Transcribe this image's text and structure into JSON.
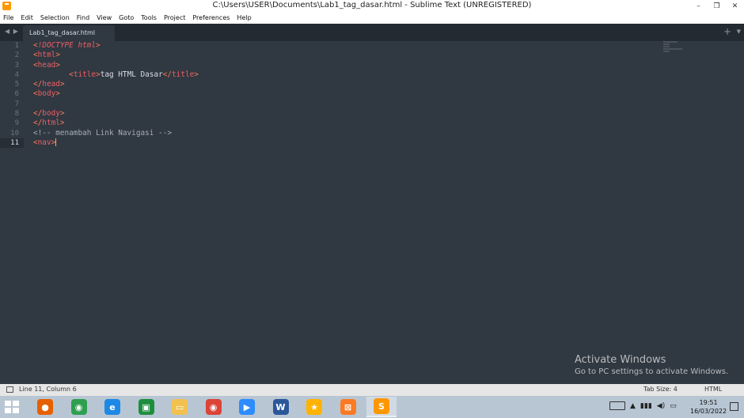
{
  "window": {
    "title": "C:\\Users\\USER\\Documents\\Lab1_tag_dasar.html - Sublime Text (UNREGISTERED)",
    "minimize_glyph": "–",
    "maximize_glyph": "❐",
    "close_glyph": "✕"
  },
  "menu": [
    "File",
    "Edit",
    "Selection",
    "Find",
    "View",
    "Goto",
    "Tools",
    "Project",
    "Preferences",
    "Help"
  ],
  "tabbar": {
    "nav_arrows": "◀ ▶",
    "active_tab": "Lab1_tag_dasar.html",
    "new_tab_glyph": "+",
    "dropdown_glyph": "▼"
  },
  "editor": {
    "line_numbers": [
      "1",
      "2",
      "3",
      "4",
      "5",
      "6",
      "7",
      "8",
      "9",
      "10",
      "11"
    ],
    "active_line": 11,
    "lines": [
      [
        {
          "t": "<",
          "c": "punct"
        },
        {
          "t": "!DOCTYPE",
          "c": "kw"
        },
        {
          "t": " html",
          "c": "kw"
        },
        {
          "t": ">",
          "c": "punct"
        }
      ],
      [
        {
          "t": "<",
          "c": "punct"
        },
        {
          "t": "html",
          "c": "tagn"
        },
        {
          "t": ">",
          "c": "punct"
        }
      ],
      [
        {
          "t": "<",
          "c": "punct"
        },
        {
          "t": "head",
          "c": "tagn"
        },
        {
          "t": ">",
          "c": "punct"
        }
      ],
      [
        {
          "t": "        ",
          "c": "txt"
        },
        {
          "t": "<",
          "c": "punct"
        },
        {
          "t": "title",
          "c": "tagn"
        },
        {
          "t": ">",
          "c": "punct"
        },
        {
          "t": "tag HTML Dasar",
          "c": "txt"
        },
        {
          "t": "</",
          "c": "punct"
        },
        {
          "t": "title",
          "c": "tagn"
        },
        {
          "t": ">",
          "c": "punct"
        }
      ],
      [
        {
          "t": "</",
          "c": "punct"
        },
        {
          "t": "head",
          "c": "tagn"
        },
        {
          "t": ">",
          "c": "punct"
        }
      ],
      [
        {
          "t": "<",
          "c": "punct"
        },
        {
          "t": "body",
          "c": "tagn"
        },
        {
          "t": ">",
          "c": "punct"
        }
      ],
      [],
      [
        {
          "t": "</",
          "c": "punct"
        },
        {
          "t": "body",
          "c": "tagn"
        },
        {
          "t": ">",
          "c": "punct"
        }
      ],
      [
        {
          "t": "</",
          "c": "punct"
        },
        {
          "t": "html",
          "c": "tagn"
        },
        {
          "t": ">",
          "c": "punct"
        }
      ],
      [
        {
          "t": "<!-- menambah Link Navigasi -->",
          "c": "comment"
        }
      ],
      [
        {
          "t": "<",
          "c": "punct"
        },
        {
          "t": "nav",
          "c": "tagn"
        },
        {
          "t": ">",
          "c": "punct"
        }
      ]
    ]
  },
  "watermark": {
    "title": "Activate Windows",
    "subtitle": "Go to PC settings to activate Windows."
  },
  "statusbar": {
    "position": "Line 11, Column 6",
    "tab_size": "Tab Size: 4",
    "syntax": "HTML"
  },
  "taskbar": {
    "apps": [
      {
        "name": "firefox-icon",
        "color": "#e66000",
        "glyph": "●"
      },
      {
        "name": "chrome-icon",
        "color": "#2e9e4f",
        "glyph": "◉"
      },
      {
        "name": "ie-icon",
        "color": "#1e88e5",
        "glyph": "e"
      },
      {
        "name": "store-icon",
        "color": "#1e8e3e",
        "glyph": "▣"
      },
      {
        "name": "file-explorer-icon",
        "color": "#f2c14e",
        "glyph": "▭"
      },
      {
        "name": "chrome-alt-icon",
        "color": "#db4437",
        "glyph": "◉"
      },
      {
        "name": "zoom-icon",
        "color": "#2d8cff",
        "glyph": "▶"
      },
      {
        "name": "word-icon",
        "color": "#2b579a",
        "glyph": "W"
      },
      {
        "name": "star-app-icon",
        "color": "#ffb300",
        "glyph": "★"
      },
      {
        "name": "xampp-icon",
        "color": "#fb7a24",
        "glyph": "⊠"
      },
      {
        "name": "sublime-icon",
        "color": "#ff9800",
        "glyph": "S"
      }
    ],
    "tray_arrow": "▲",
    "tray_signal": "▮▮▮",
    "tray_volume": "◀)",
    "tray_battery": "▭",
    "time": "19:51",
    "date": "16/03/2022"
  }
}
